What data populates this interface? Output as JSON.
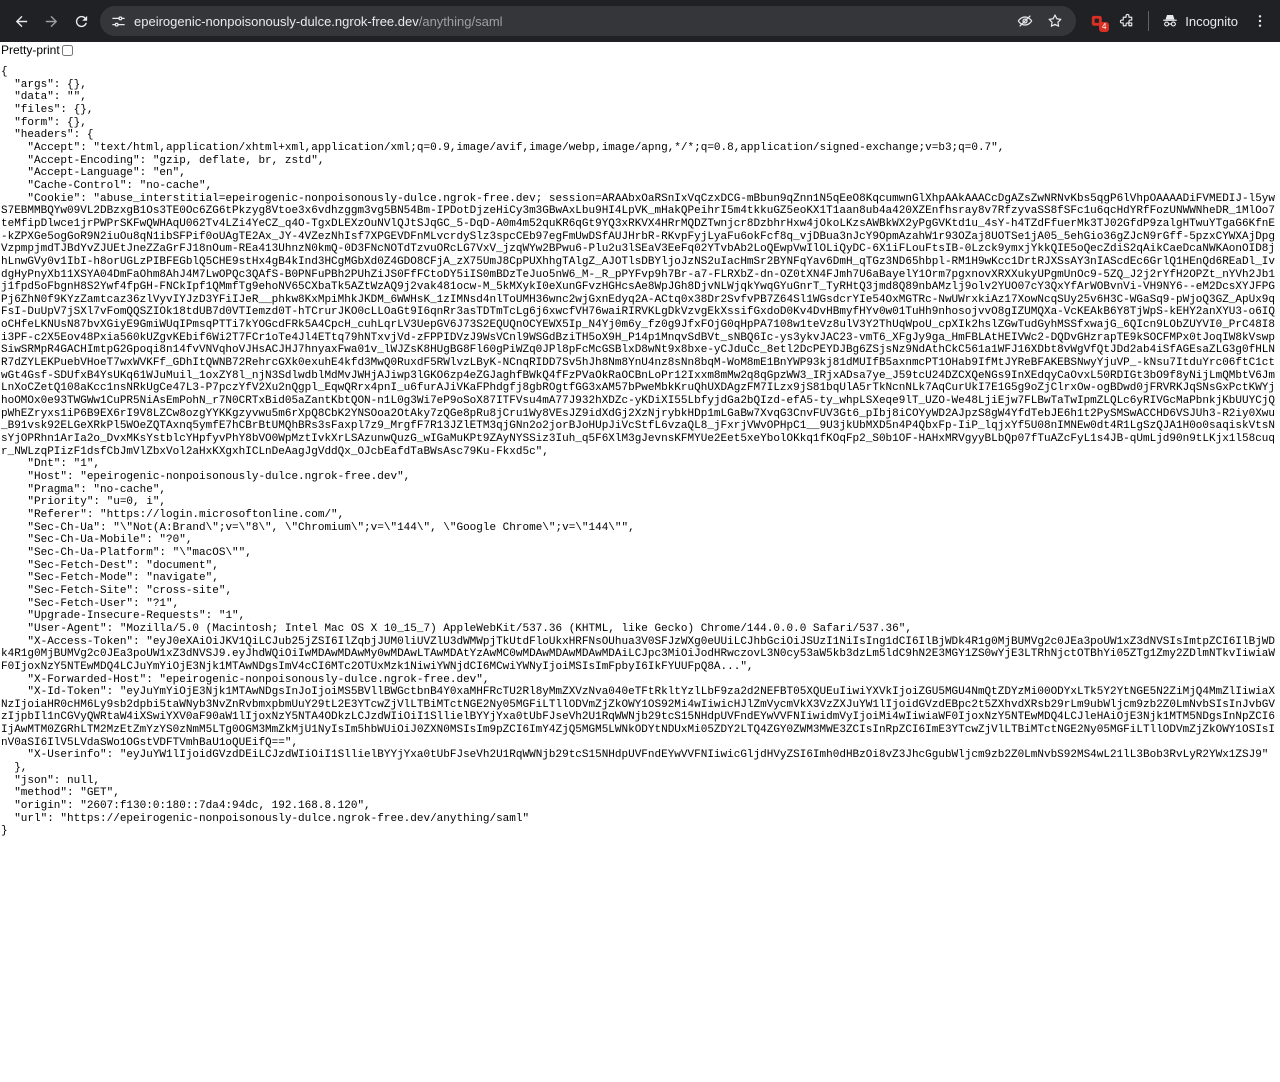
{
  "browser": {
    "url_host": "epeirogenic-nonpoisonously-dulce.ngrok-free.dev",
    "url_path": "/anything/saml",
    "extension_badge": "4",
    "incognito_label": "Incognito"
  },
  "page": {
    "pretty_print_label": "Pretty-print",
    "json_lines": [
      "{",
      "  \"args\": {},",
      "  \"data\": \"\",",
      "  \"files\": {},",
      "  \"form\": {},",
      "  \"headers\": {",
      "    \"Accept\": \"text/html,application/xhtml+xml,application/xml;q=0.9,image/avif,image/webp,image/apng,*/*;q=0.8,application/signed-exchange;v=b3;q=0.7\",",
      "    \"Accept-Encoding\": \"gzip, deflate, br, zstd\",",
      "    \"Accept-Language\": \"en\",",
      "    \"Cache-Control\": \"no-cache\",",
      "    \"Cookie\": \"abuse_interstitial=epeirogenic-nonpoisonously-dulce.ngrok-free.dev; session=ARAAbxOaRSnIxVqCzxDCG-mBbun9qZnn1N5qEeO8KqcumwnGlXhpAAkAAACcDgAZsZwNRNvKbs5qgP6lVhpOAAAADiFVMEDIJ-l5ywS7EBMMBQYw09VL2DBzxgB1Os3TE0Oc6ZG6tPkzyg8Vtoe3x6vdhzggm3vg5BN54Bm-IPDotDjzeHiCy3m3GBwAxLbu9HI4LpVK_mHakQPeihrI5m4tkkuGZ5eoKX1T1aan8ub4a420XZEnfhsray8v7RfzyvaSS8fSFc1u6qcHdYRfFozUNWWNheDR_1MlOo7teMfipDlwce1jrPWPrSKFwQWHAqU062Tv4LZi4YeCZ_q4O-TgxDLEXzOuNVlQJtSJqGC_5-DqD-A0m4m52quKR6qGt9YQ3xRKVX4HRrMQDZTwnjcr8DzbhrHxw4jOkoLKzsAWBkWX2yPgGVKtd1u_4sY-h4TZdFfuerMk3TJ02GfdP9zalgHTwuYTgaG6KfnE-kZPXGe5ogGoR9N2iuOu8qN1ibSFPif0oUAgTE2Ax_JY-4VZezNhIsf7XPGEVDFnMLvcrdySlz3spcCEb97egFmUwDSfAUJHrbR-RKvpFyjLyaFu6okFcf8q_vjDBua3nJcY9OpmAzahW1r93OZaj8UOTSe1jA05_5ehGio36gZJcN9rGff-5pzxCYWXAjDpgVzpmpjmdTJBdYvZJUEtJneZZaGrFJ18nOum-REa413UhnzN0kmQ-0D3FNcNOTdTzvuORcLG7VxV_jzqWYw2BPwu6-Plu2u3lSEaV3EeFq02YTvbAb2LoQEwpVwIlOLiQyDC-6X1iFLouFtsIB-0Lzck9ymxjYkkQIE5oQecZdiS2qAikCaeDcaNWKAonOID8jhLnwGVy0v1IbI-h8orUGLzPIBFEGblQ5CHE9stHx4gB4kInd3HCgMGbXd0Z4GDO8CFjA_zX75UmJ8CpPUXhhgTAlgZ_AJOTlsDBYljoJzNS2uIacHmSr2BYNFqYav6DmH_qTGz3ND65hbpl-RM1H9wKcc1DrtRJXSsAY3nIAScdEc6GrlQ1HEnQd6REaDl_IvdgHyPnyXb11XSYA04DmFaOhm8AhJ4M7LwOPQc3QAfS-B0PNFuPBh2PUhZiJS0FfFCtoDY5iIS0mBDzTeJuo5nW6_M-_R_pPYFvp9h7Br-a7-FLRXbZ-dn-OZ0tXN4FJmh7U6aBayelY1Orm7pgxnovXRXXukyUPgmUnOc9-5ZQ_J2j2rYfH2OPZt_nYVh2Jb1j1fpd5oFbgnH8S2Ywf4fpGH-FNCkIpf1QMmfTg9ehoNV65CXbaTk5AZtWzAQ9j2vak481ocw-M_5kMXykI0eXunGFvzHGHcsAe8WpJGh8DjvNLWjqkYwqGYuGnrT_TyRHtQ3jmd8Q89nbAMzlj9olv2YUO07cY3QxYfArWOBvnVi-VH9NY6--eM2DcsXYJFPGPj6ZhN0f9KYzZamtcaz36zlVyvIYJzD3YFiIJeR__phkw8KxMpiMhkJKDM_6WWHsK_1zIMNsd4nlToUMH36wnc2wjGxnEdyq2A-ACtq0x38Dr2SvfvPB7Z64Sl1WGsdcrYIe54OxMGTRc-NwUWrxkiAz17XowNcqSUy25v6H3C-WGaSq9-pWjoQ3GZ_ApUx9qFsI-DuUpV7jSXl7vFomQQSZIOk18tdUB7d0VTIemzd0T-hTCrurJKO0cLLOaGt9I6qnRr3asTDTmTcLg6j6xwcfVH76waiRIRVKLgDkVzvgEkXssifGxdoD0Kv4DvHBmyfHYv0w01TuHh9nhosojvvO8gIZUMQXa-VcKEAkB6Y8TjWpS-kEHY2anXYU3-o6IQoCHfeLKNUsN87bvXGiyE9GmiWUqIPmsqPTTi7kYOGcdFRk5A4CpcH_cuhLqrLV3UepGV6J73S2EQUQnOCYEWX5Ip_N4Yj0m6y_fz0g9JfxFOjG0qHpPA7108w1teVz8ulV3Y2ThUqWpoU_cpXIk2hslZGwTudGyhMSSfxwajG_6QIcn9LObZUYVI0_PrC48I8i3PF-c2X5Eov48Pxia560kUZgvKEbif6Wi2T7FCr1oTe4Jl4ETtq79hNTxvjVd-zFPPIDVzJ9WsVCnl9WSGdBziTH5oX9H_P14p1MnqvSdBVt_sNBQ6Ic-ys3ykvJAC23-vmT6_XFgJy9ga_HmFBLAtHEIVWc2-DQDvGHzrapTE9kSOCFMPx0tJoqIW8kVswpSiwSRMpR4GACHImtpG2Gpoqi8n14fvVNVqhoVJHsACJHJ7hnyaxFwa01v_lWJZsK8HUgBG8Fl60gPiWZq0JPl8pFcMcGSBlxD8wNt9x8bxe-yCJduCc_8etl2DcPEYDJBg6ZSjsNz9NdAthCkC561a1WFJ16XDbt8vWgVfQtJDd2ab4iSfAGEsaZLG3g0fHLNR7dZYLEKPuebVHoeT7wxWVKFf_GDhItQWNB72RehrcGXk0exuhE4kfd3MwQ0RuxdF5RWlvzLByK-NCnqRIDD7Sv5hJh8Nm8YnU4nz8sNn8bqM-WoM8mE1BnYWP93kj81dMUIfB5axnmcPT1OHab9IfMtJYReBFAKEBSNwyYjuVP_-kNsu7ItduYrc06ftC1ctwGt4Gsf-SDUfxB4YsUKq61WJuMuil_1oxZY8l_njN3SdlwdblMdMvJWHjAJiwp3lGKO6zp4eZGJaghfBWkQ4fFzPVaOkRaOCBnLoPr12Ixxm8mMw2q8qGpzWW3_IRjxADsa7ye_J59tcU24DZCXQeNGs9InXEdqyCaOvxL50RDIGt3bO9f8yNijLmQMbtV6JmLnXoCZetQ108aKcc1nsNRkUgCe47L3-P7pczYfV2Xu2nQgpl_EqwQRrx4pnI_u6furAJiVKaFPhdgfj8gbROgtfGG3xAM57bPweMbkKruQhUXDAgzFM7ILzx9jS81bqUlA5rTkNcnNLk7AqCurUkI7E1G5g9oZjClrxOw-ogBDwd0jFRVRKJqSNsGxPctKWYjhoOMOx0e93TWGWw1CuPR5NiAsEmPohN_r7N0CRTxBid05aZantKbtQON-n1L0g3Wi7eP9oSoX87ITFVsu4mA77J932hXDZc-yKDiXI55LbfyjdGa2bQIzd-efA5-ty_whpLSXeqe9lT_UZO-We48LjiEjw7FLBwTaTwIpmZLQLc6yRIVGcMaPbnkjKbUUYCjQpWhEZryxs1iP6B9EX6rI9V8LZCw8ozgYYKKgzyvwu5m6rXpQ8CbK2YNSOoa2OtAky7zQGe8pRu8jCru1Wy8VEsJZ9idXdGj2XzNjrybkHDp1mLGaBw7XvqG3CnvFUV3Gt6_pIbj8iCOYyWD2AJpzS8gW4YfdTebJE6h1t2PySMSwACCHD6VSJUh3-R2iy0Xwu_B91vsk92ELGeXRkPl5WOeZQTAxnq5ymfE7hCBrBtUMQhBRs3sFaxpl7z9_MrgfF7R13JZlETM3qjGNn2o2jorBJoHUpJiVcStfL6vzaQL8_jFxrjVWvOPHpC1__9U3jkUbMXD5n4P4QbxFp-IiP_lqjxYf5U08nIMNEw0dt4R1LgSzQJA1H0o0saqiskVtsNsYjOPRhn1ArIa2o_DvxMKsYstblcYHpfyvPhY8bVO0WpMztIvkXrLSAzunwQuzG_wIGaMuKPt9ZAyNYSSiz3Iuh_q5F6XlM3gJevnsKFMYUe2Eet5xeYbolOKkq1fKOqFp2_S0b1OF-HAHxMRVgyyBLbQp07fTuAZcFyL1s4JB-qUmLjd90n9tLKjx1l58cuqr_NWLzqPIizF1dsfCbJmVlZbxVol2aHxKXgxhICLnDeAagJgVddQx_OJcbEafdTaBWsAsc79Ku-Fkxd5c\",",
      "    \"Dnt\": \"1\",",
      "    \"Host\": \"epeirogenic-nonpoisonously-dulce.ngrok-free.dev\",",
      "    \"Pragma\": \"no-cache\",",
      "    \"Priority\": \"u=0, i\",",
      "    \"Referer\": \"https://login.microsoftonline.com/\",",
      "    \"Sec-Ch-Ua\": \"\\\"Not(A:Brand\\\";v=\\\"8\\\", \\\"Chromium\\\";v=\\\"144\\\", \\\"Google Chrome\\\";v=\\\"144\\\"\",",
      "    \"Sec-Ch-Ua-Mobile\": \"?0\",",
      "    \"Sec-Ch-Ua-Platform\": \"\\\"macOS\\\"\",",
      "    \"Sec-Fetch-Dest\": \"document\",",
      "    \"Sec-Fetch-Mode\": \"navigate\",",
      "    \"Sec-Fetch-Site\": \"cross-site\",",
      "    \"Sec-Fetch-User\": \"?1\",",
      "    \"Upgrade-Insecure-Requests\": \"1\",",
      "    \"User-Agent\": \"Mozilla/5.0 (Macintosh; Intel Mac OS X 10_15_7) AppleWebKit/537.36 (KHTML, like Gecko) Chrome/144.0.0.0 Safari/537.36\",",
      "    \"X-Access-Token\": \"eyJ0eXAiOiJKV1QiLCJub25jZSI6IlZqbjJUM0liUVZlU3dWMWpjTkUtdFloUkxHRFNsOUhua3V0SFJzWXg0eUUiLCJhbGciOiJSUzI1NiIsIng1dCI6IlBjWDk4R1g0MjBUMVg2c0JEa3poUW1xZ3dNVSIsImtpZCI6IlBjWDk4R1g0MjBUMVg2c0JEa3poUW1xZ3dNVSJ9.eyJhdWQiOiIwMDAwMDAwMy0wMDAwLTAwMDAtYzAwMC0wMDAwMDAwMDAwMDAiLCJpc3MiOiJodHRwczovL3N0cy53aW5kb3dzLm5ldC9hN2E3MGY1ZS0wYjE3LTRhNjctOTBhYi05ZTg1Zmy2ZDlmNTkvIiwiaWF0IjoxNzY5NTEwMDQ4LCJuYmYiOjE3Njk1MTAwNDgsImV4cCI6MTc2OTUxMzk1NiwiYWNjdCI6MCwiYWNyIjoiMSIsImFpbyI6IkFYUUFpQ8A...\",",
      "    \"X-Forwarded-Host\": \"epeirogenic-nonpoisonously-dulce.ngrok-free.dev\",",
      "    \"X-Id-Token\": \"eyJuYmYiOjE3Njk1MTAwNDgsInJoIjoiMS5BVllBWGctbnB4Y0xaMHFRcTU2Rl8yMmZXVzNva040eTFtRkltYzlLbF9za2d2NEFBT05XQUEuIiwiYXVkIjoiZGU5MGU4NmQtZDYzMi00ODYxLTk5Y2YtNGE5N2ZiMjQ4MmZlIiwiaXNzIjoiaHR0cHM6Ly9sb2dpbi5taWNyb3NvZnRvbmxpbmUuY29tL2E3YTcwZjVlLTBiMTctNGE2Ny05MGFiLTllODVmZjZkOWY1OS92Mi4wIiwicHJlZmVycmVkX3VzZXJuYW1lIjoidGVzdEBpc2t5ZXhvdXRsb29rLm9ubWljcm9zb2Z0LmNvbSIsInJvbGVzIjpbIl1nCGVyQWRtaW4iXSwiYXV0aF90aW1lIjoxNzY5NTA4ODkzLCJzdWIiOiI1SllielBYYjYxa0tUbFJseVh2U1RqWWNjb29tcS15NHdpUVFndEYwVVFNIiwidmVyIjoiMi4wIiwiaWF0IjoxNzY5NTEwMDQ4LCJleHAiOjE3Njk1MTM5NDgsInNpZCI6IjAwMTM0ZGRhLTM2MzEtZmYzYS0zNmM5LTg0OGM3MmZkMjU1NyIsIm5hbWUiOiJ0ZXN0MSIsIm9pZCI6ImY4ZjQ5MGM5LWNkODYtNDUxMi05ZDY2LTQ4ZGY0ZWM3MWE3ZCIsInRpZCI6ImE3YTcwZjVlLTBiMTctNGE2Ny05MGFiLTllODVmZjZkOWY1OSIsInV0aSI6IlV5LVdaSWo1OGstVDFTVmhBaU1oQUEifQ==\",",
      "    \"X-Userinfo\": \"eyJuYW1lIjoidGVzdDEiLCJzdWIiOiI1SllielBYYjYxa0tUbFJseVh2U1RqWWNjb29tcS15NHdpUVFndEYwVVFNIiwicGljdHVyZSI6Imh0dHBzOi8vZ3JhcGgubWljcm9zb2Z0LmNvbS92MS4wL21lL3Bob3RvLyR2YWx1ZSJ9\"",
      "  },",
      "  \"json\": null,",
      "  \"method\": \"GET\",",
      "  \"origin\": \"2607:f130:0:180::7da4:94dc, 192.168.8.120\",",
      "  \"url\": \"https://epeirogenic-nonpoisonously-dulce.ngrok-free.dev/anything/saml\"",
      "}"
    ]
  }
}
